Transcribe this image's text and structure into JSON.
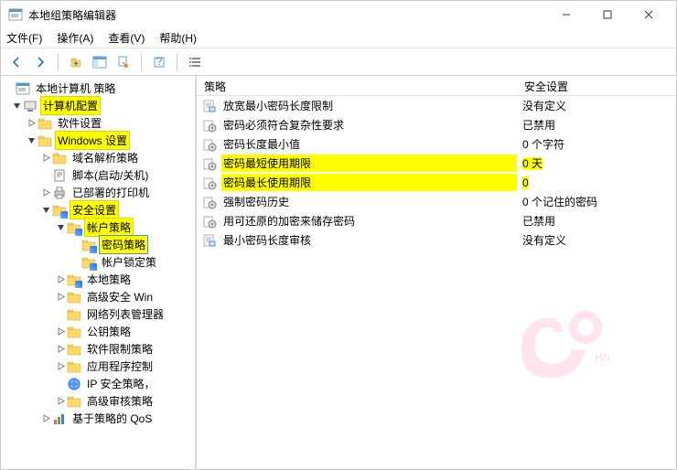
{
  "window": {
    "title": "本地组策略编辑器"
  },
  "menu": {
    "file": "文件(F)",
    "action": "操作(A)",
    "view": "查看(V)",
    "help": "帮助(H)"
  },
  "tree": {
    "root": "本地计算机 策略",
    "n1": "计算机配置",
    "n1_1": "软件设置",
    "n1_2": "Windows 设置",
    "n1_2_1": "域名解析策略",
    "n1_2_2": "脚本(启动/关机)",
    "n1_2_3": "已部署的打印机",
    "n1_2_4": "安全设置",
    "n1_2_4_1": "帐户策略",
    "n1_2_4_1_1": "密码策略",
    "n1_2_4_1_2": "帐户锁定策",
    "n1_2_4_2": "本地策略",
    "n1_2_4_3": "高级安全 Win",
    "n1_2_4_4": "网络列表管理器",
    "n1_2_4_5": "公钥策略",
    "n1_2_4_6": "软件限制策略",
    "n1_2_4_7": "应用程序控制",
    "n1_2_4_8": "IP 安全策略，",
    "n1_2_4_9": "高级审核策略",
    "n1_2_5": "基于策略的 QoS"
  },
  "list": {
    "head_policy": "策略",
    "head_setting": "安全设置",
    "rows": [
      {
        "policy": "放宽最小密码长度限制",
        "setting": "没有定义",
        "hl": false,
        "icon": "policy"
      },
      {
        "policy": "密码必须符合复杂性要求",
        "setting": "已禁用",
        "hl": false,
        "icon": "gear"
      },
      {
        "policy": "密码长度最小值",
        "setting": "0 个字符",
        "hl": false,
        "icon": "gear"
      },
      {
        "policy": "密码最短使用期限",
        "setting": "0 天",
        "hl": true,
        "icon": "gear"
      },
      {
        "policy": "密码最长使用期限",
        "setting": "0",
        "hl": true,
        "icon": "gear"
      },
      {
        "policy": "强制密码历史",
        "setting": "0 个记住的密码",
        "hl": false,
        "icon": "gear"
      },
      {
        "policy": "用可还原的加密来储存密码",
        "setting": "已禁用",
        "hl": false,
        "icon": "gear"
      },
      {
        "policy": "最小密码长度审核",
        "setting": "没有定义",
        "hl": false,
        "icon": "policy"
      }
    ]
  }
}
